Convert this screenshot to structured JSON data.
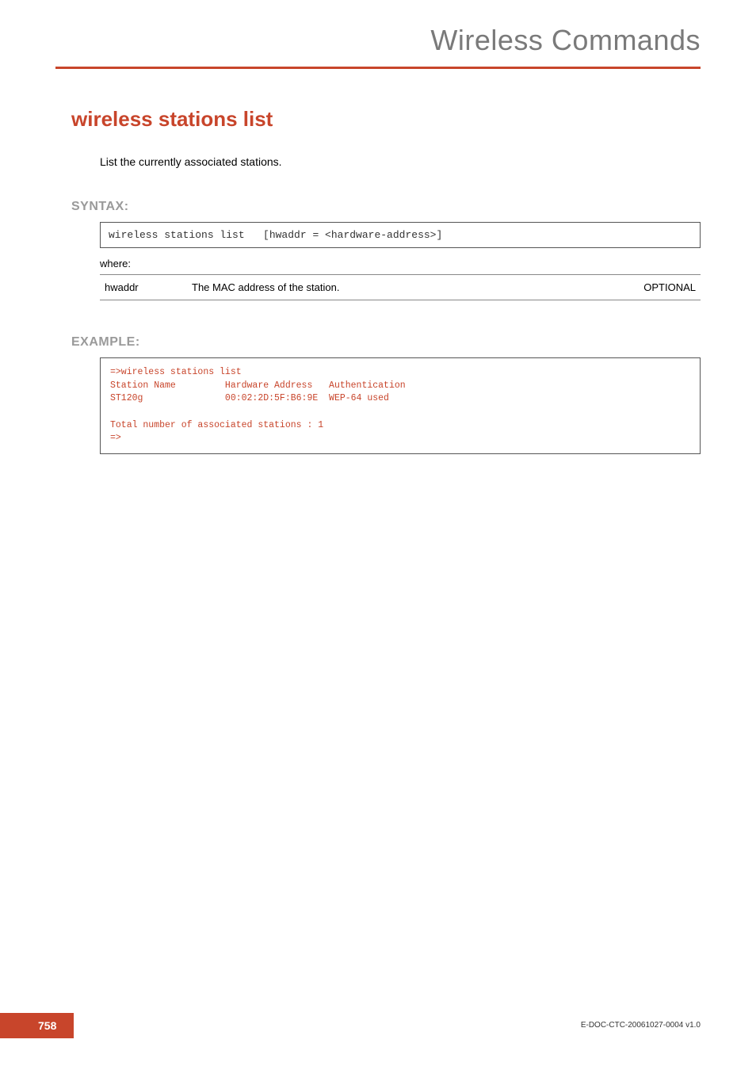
{
  "header": {
    "chapter_title": "Wireless Commands"
  },
  "command": {
    "title": "wireless stations list",
    "description": "List the currently associated stations."
  },
  "syntax": {
    "label": "SYNTAX:",
    "line": "wireless stations list   [hwaddr = <hardware-address>]",
    "where_label": "where:",
    "params": [
      {
        "name": "hwaddr",
        "desc": "The MAC address of the station.",
        "opt": "OPTIONAL"
      }
    ]
  },
  "example": {
    "label": "EXAMPLE:",
    "lines": "=>wireless stations list\nStation Name         Hardware Address   Authentication\nST120g               00:02:2D:5F:B6:9E  WEP-64 used\n\nTotal number of associated stations : 1\n=>"
  },
  "footer": {
    "page_number": "758",
    "doc_id": "E-DOC-CTC-20061027-0004 v1.0"
  }
}
